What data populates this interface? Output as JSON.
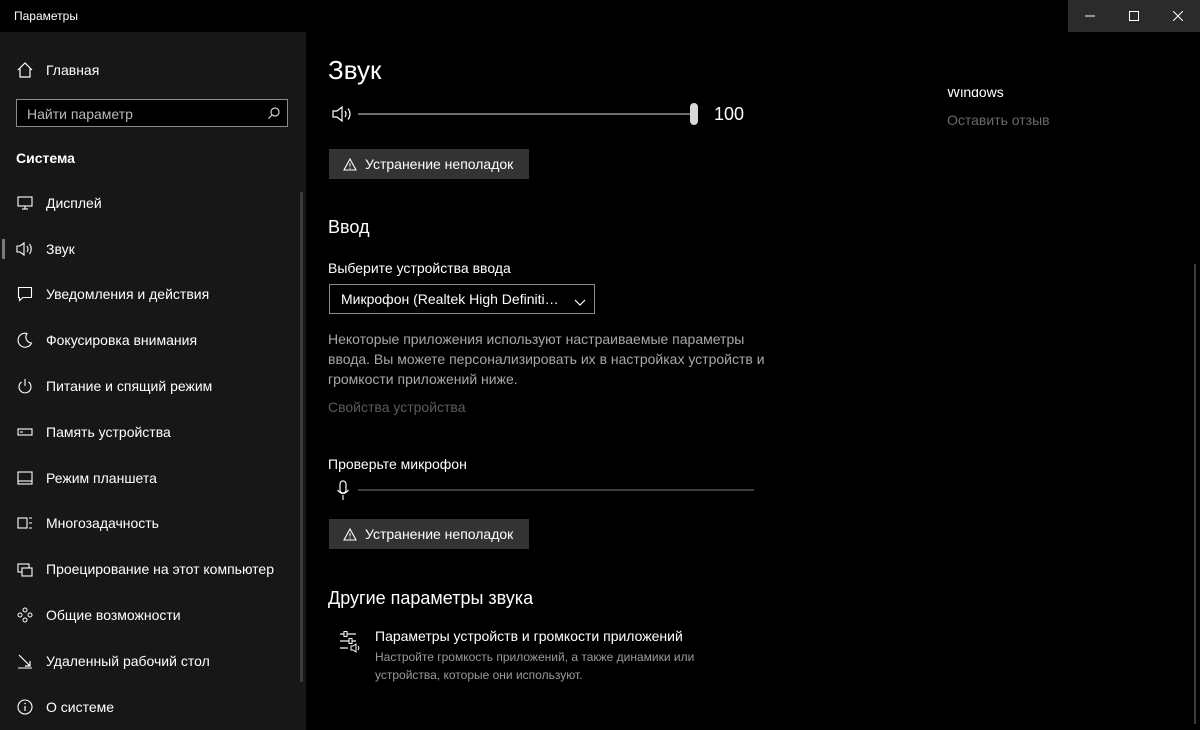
{
  "window": {
    "title": "Параметры"
  },
  "sidebar": {
    "home": "Главная",
    "search_placeholder": "Найти параметр",
    "section": "Система",
    "items": [
      {
        "label": "Дисплей",
        "icon": "monitor-icon"
      },
      {
        "label": "Звук",
        "icon": "speaker-icon",
        "active": true
      },
      {
        "label": "Уведомления и действия",
        "icon": "notification-icon"
      },
      {
        "label": "Фокусировка внимания",
        "icon": "moon-icon"
      },
      {
        "label": "Питание и спящий режим",
        "icon": "power-icon"
      },
      {
        "label": "Память устройства",
        "icon": "storage-icon"
      },
      {
        "label": "Режим планшета",
        "icon": "tablet-icon"
      },
      {
        "label": "Многозадачность",
        "icon": "multitask-icon"
      },
      {
        "label": "Проецирование на этот компьютер",
        "icon": "project-icon"
      },
      {
        "label": "Общие возможности",
        "icon": "shared-icon"
      },
      {
        "label": "Удаленный рабочий стол",
        "icon": "remote-desktop-icon"
      },
      {
        "label": "О системе",
        "icon": "info-icon"
      }
    ]
  },
  "main": {
    "title": "Звук",
    "volume": {
      "value": "100",
      "level": 1.0
    },
    "troubleshoot_label": "Устранение неполадок",
    "input": {
      "heading": "Ввод",
      "choose_label": "Выберите устройства ввода",
      "device_selected": "Микрофон (Realtek High Definiti…",
      "description": "Некоторые приложения используют настраиваемые параметры ввода. Вы можете персонализировать их в настройках устройств и громкости приложений ниже.",
      "properties_link": "Свойства устройства",
      "test_label": "Проверьте микрофон",
      "mic_level": 0.0
    },
    "other": {
      "heading": "Другие параметры звука",
      "app_volume_title": "Параметры устройств и громкости приложений",
      "app_volume_desc": "Настройте громкость приложений, а также динамики или устройства, которые они используют."
    }
  },
  "right": {
    "windows_text": "Windows",
    "feedback": "Оставить отзыв"
  }
}
